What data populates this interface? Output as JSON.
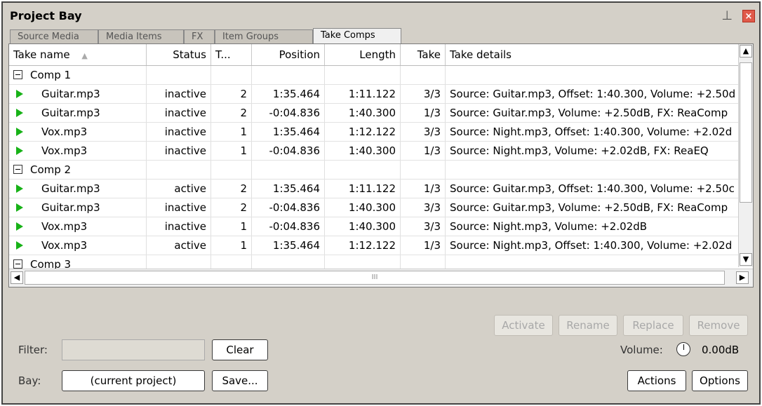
{
  "window": {
    "title": "Project Bay",
    "pin_icon": "pin-icon",
    "close_icon": "close-icon",
    "close_glyph": "×",
    "pin_glyph": "⊥"
  },
  "tabs": [
    {
      "label": "Source Media"
    },
    {
      "label": "Media Items"
    },
    {
      "label": "FX"
    },
    {
      "label": "Item Groups"
    },
    {
      "label": "Take Comps"
    }
  ],
  "active_tab": "Take Comps",
  "columns": {
    "take_name": "Take name",
    "status": "Status",
    "t": "T...",
    "position": "Position",
    "length": "Length",
    "take": "Take",
    "take_details": "Take details",
    "sort_glyph": "▲"
  },
  "rows": [
    {
      "type": "group",
      "name": "Comp 1"
    },
    {
      "type": "item",
      "name": "Guitar.mp3",
      "status": "inactive",
      "t": "2",
      "position": "1:35.464",
      "length": "1:11.122",
      "take": "3/3",
      "details": "Source: Guitar.mp3, Offset: 1:40.300, Volume: +2.50d"
    },
    {
      "type": "item",
      "name": "Guitar.mp3",
      "status": "inactive",
      "t": "2",
      "position": "-0:04.836",
      "length": "1:40.300",
      "take": "1/3",
      "details": "Source: Guitar.mp3, Volume: +2.50dB, FX: ReaComp"
    },
    {
      "type": "item",
      "name": "Vox.mp3",
      "status": "inactive",
      "t": "1",
      "position": "1:35.464",
      "length": "1:12.122",
      "take": "3/3",
      "details": "Source: Night.mp3, Offset: 1:40.300, Volume: +2.02d"
    },
    {
      "type": "item",
      "name": "Vox.mp3",
      "status": "inactive",
      "t": "1",
      "position": "-0:04.836",
      "length": "1:40.300",
      "take": "1/3",
      "details": "Source: Night.mp3, Volume: +2.02dB, FX: ReaEQ"
    },
    {
      "type": "group",
      "name": "Comp 2"
    },
    {
      "type": "item",
      "name": "Guitar.mp3",
      "status": "active",
      "t": "2",
      "position": "1:35.464",
      "length": "1:11.122",
      "take": "1/3",
      "details": "Source: Guitar.mp3, Offset: 1:40.300, Volume: +2.50c"
    },
    {
      "type": "item",
      "name": "Guitar.mp3",
      "status": "inactive",
      "t": "2",
      "position": "-0:04.836",
      "length": "1:40.300",
      "take": "3/3",
      "details": "Source: Guitar.mp3, Volume: +2.50dB, FX: ReaComp"
    },
    {
      "type": "item",
      "name": "Vox.mp3",
      "status": "inactive",
      "t": "1",
      "position": "-0:04.836",
      "length": "1:40.300",
      "take": "3/3",
      "details": "Source: Night.mp3, Volume: +2.02dB"
    },
    {
      "type": "item",
      "name": "Vox.mp3",
      "status": "active",
      "t": "1",
      "position": "1:35.464",
      "length": "1:12.122",
      "take": "1/3",
      "details": "Source: Night.mp3, Offset: 1:40.300, Volume: +2.02d"
    },
    {
      "type": "group",
      "name": "Comp 3"
    }
  ],
  "scrollbars": {
    "up": "▲",
    "down": "▼",
    "left": "◀",
    "right": "▶",
    "hthumb_grip": "III"
  },
  "actions_row": {
    "activate": "Activate",
    "rename": "Rename",
    "replace": "Replace",
    "remove": "Remove"
  },
  "filter": {
    "label": "Filter:",
    "value": "",
    "clear": "Clear"
  },
  "bay": {
    "label": "Bay:",
    "value": "(current project)",
    "save": "Save..."
  },
  "volume": {
    "label": "Volume:",
    "value": "0.00dB",
    "knob_icon": "volume-knob-icon"
  },
  "bottom_buttons": {
    "actions": "Actions",
    "options": "Options"
  },
  "colors": {
    "play_icon": "#17b217",
    "window_bg": "#d4d0c8",
    "close_bg": "#e05a4a"
  }
}
